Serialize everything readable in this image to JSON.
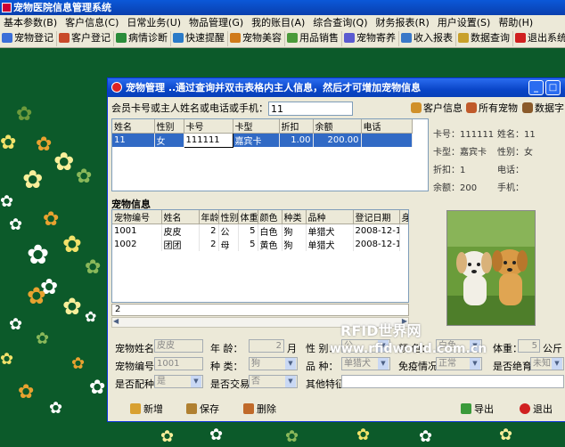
{
  "app": {
    "title": "宠物医院信息管理系统"
  },
  "menu": [
    "基本参数(B)",
    "客户信息(C)",
    "日常业务(U)",
    "物品管理(G)",
    "我的账目(A)",
    "综合查询(Q)",
    "财务报表(R)",
    "用户设置(S)",
    "帮助(H)"
  ],
  "toolbar": [
    {
      "label": "宠物登记",
      "icon": "pet-register-icon",
      "color": "#3b6fd8"
    },
    {
      "label": "客户登记",
      "icon": "customer-register-icon",
      "color": "#c84a2a"
    },
    {
      "label": "病情诊断",
      "icon": "diagnosis-icon",
      "color": "#2a8c3a"
    },
    {
      "label": "快速提醒",
      "icon": "reminder-icon",
      "color": "#2a7ac8"
    },
    {
      "label": "宠物美容",
      "icon": "pet-beauty-icon",
      "color": "#d07a1a"
    },
    {
      "label": "用品销售",
      "icon": "sales-icon",
      "color": "#4a9a3a"
    },
    {
      "label": "宠物寄养",
      "icon": "boarding-icon",
      "color": "#5a5ad0"
    },
    {
      "label": "收入报表",
      "icon": "income-report-icon",
      "color": "#3a78c8"
    },
    {
      "label": "数据查询",
      "icon": "data-query-icon",
      "color": "#c8a02a"
    },
    {
      "label": "退出系统",
      "icon": "exit-icon",
      "color": "#d02020"
    }
  ],
  "dialog": {
    "title": "宠物管理  ..通过查询并双击表格内主人信息，然后才可增加宠物信息",
    "search_label": "会员卡号或主人姓名或电话或手机：",
    "search_value": "11",
    "quick": [
      "客户信息",
      "所有宠物",
      "数据字"
    ],
    "owners": {
      "headers": [
        "姓名",
        "性别",
        "卡号",
        "卡型",
        "折扣",
        "余额",
        "电话"
      ],
      "rows": [
        [
          "11",
          "女",
          "111111",
          "嘉宾卡",
          "1.00",
          "200.00",
          ""
        ]
      ]
    },
    "info": {
      "card_no": "卡号：111111",
      "name": "姓名：11",
      "card_type": "卡型：嘉宾卡",
      "gender": "性别：女",
      "discount": "折扣：1",
      "phone": "电话：",
      "balance": "余额：200",
      "mobile": "手机："
    },
    "pets_title": "宠物信息",
    "pets": {
      "headers": [
        "宠物编号",
        "姓名",
        "年龄",
        "性别",
        "体重",
        "颜色",
        "种类",
        "品种",
        "登记日期",
        "身"
      ],
      "rows": [
        [
          "1001",
          "皮皮",
          "2",
          "公",
          "5",
          "白色",
          "狗",
          "单猎犬",
          "2008-12-10",
          ""
        ],
        [
          "1002",
          "团团",
          "2",
          "母",
          "5",
          "黄色",
          "狗",
          "单猎犬",
          "2008-12-10",
          ""
        ]
      ]
    },
    "pet_count": "2",
    "form": {
      "pet_name_label": "宠物姓名：",
      "pet_name_value": "皮皮",
      "age_label": "年   龄：",
      "age_value": "2",
      "age_unit": "月",
      "gender_label": "性   别：",
      "gender_value": "公",
      "color_label": "颜   色：",
      "color_value": "白色",
      "weight_label": "体重：",
      "weight_value": "5",
      "weight_unit": "公斤",
      "pet_no_label": "宠物编号：",
      "pet_no_value": "1001",
      "kind_label": "种   类：",
      "kind_value": "狗",
      "breed_label": "品   种：",
      "breed_value": "单猎犬",
      "immunity_label": "免疫情况：",
      "immunity_value": "正常",
      "sterilized_label": "是否绝育：",
      "sterilized_value": "未知",
      "breeding_label": "是否配种：",
      "breeding_value": "是",
      "trade_label": "是否交易：",
      "trade_value": "否",
      "other_label": "其他特征：",
      "other_value": ""
    },
    "buttons": {
      "add": "新增",
      "save": "保存",
      "delete": "删除",
      "export": "导出",
      "exit": "退出"
    }
  },
  "watermark": {
    "line1": "RFID世界网",
    "line2": "www.rfidworld.com.cn"
  }
}
